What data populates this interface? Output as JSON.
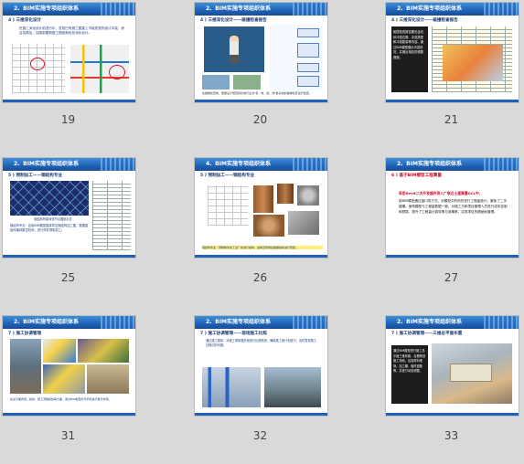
{
  "slides": [
    {
      "number": "19",
      "header": "2、BIM实施专项组织体系",
      "subtitle": "4 ) 三维深化设计",
      "body": "在施工深化设计前进行中，发现已有施工图重上不能发现的设计冲突，综合实践及，加强制图和施工图纸和优化深化设计。"
    },
    {
      "number": "20",
      "header": "2、BIM实施专项组织体系",
      "subtitle": "4 ) 三维深化设计——碰撞检查报告",
      "body": "在碰撞检查前，根据设计规范和机电行业对\"机、电、给、排\"各系统的碰撞检查进行检查。"
    },
    {
      "number": "21",
      "header": "2、BIM实施专项组织体系",
      "subtitle": "4 ) 三维深化设计——碰撞检查报告",
      "body": "碰撞检查报告要包含具体冲突位置、冲突类型和冲突数量等内容。通过BIM模型展示冲突情况，并做出相应的调整措施。"
    },
    {
      "number": "25",
      "header": "2、BIM实施专项组织体系",
      "subtitle": "5 ) 预制加工——钢结构专业",
      "body": "钢结构专业：应用BIM模型直接导出钢结构加工图，数据直接传输到数控机床，进行构件预制加工。",
      "caption": "钢结构桁架深化节点图纸示意"
    },
    {
      "number": "26",
      "header": "4、BIM实施专项组织体系",
      "subtitle": "5 ) 预制加工——钢结构专业",
      "body": "钢结构专业：预制构件加工出厂前进行编码，运输至现场后根据编码进行安装。"
    },
    {
      "number": "27",
      "header": "2、BIM实施专项组织体系",
      "subtitle": "6 ) 基于BIM模型工程算量",
      "body_red": "采用Revit二次开发插件导入广联达土建算量GCL中，",
      "body": "将BIM模型通过接口的方式，对模型中的构件进行工程量统计，避免了二次建模。使构模型与工程量数据一致，对施工方和项目管理人员进行成本控制和预算，提升了工程量计算效率与准确率，实现项目的精细化管理。"
    },
    {
      "number": "31",
      "header": "2、BIM实施专项组织体系",
      "subtitle": "7 ) 施工协调管理",
      "body": "在总平面布置、模拟、施工流程模拟等方面，通过BIM模型的可视化进行各方协调。"
    },
    {
      "number": "32",
      "header": "2、BIM实施专项组织体系",
      "subtitle": "7 ) 施工协调管理——现场施工比照",
      "body": "通过施工模拟，对施工现场各阶段进行比照检查，确保施工按计划进行，及时发现施工过程中的问题。"
    },
    {
      "number": "33",
      "header": "2、BIM实施专项组织体系",
      "subtitle": "7 ) 施工协调管理——三维总平面布置",
      "body": "通过BIM模型进行施工总平面三维布置，合理规划施工场地，包括材料堆场、加工棚、临时道路等，并进行动态调整。"
    }
  ],
  "colors": {
    "header_blue": "#1f62b8",
    "accent_red": "#c8102e",
    "background": "#d9d9d9"
  }
}
